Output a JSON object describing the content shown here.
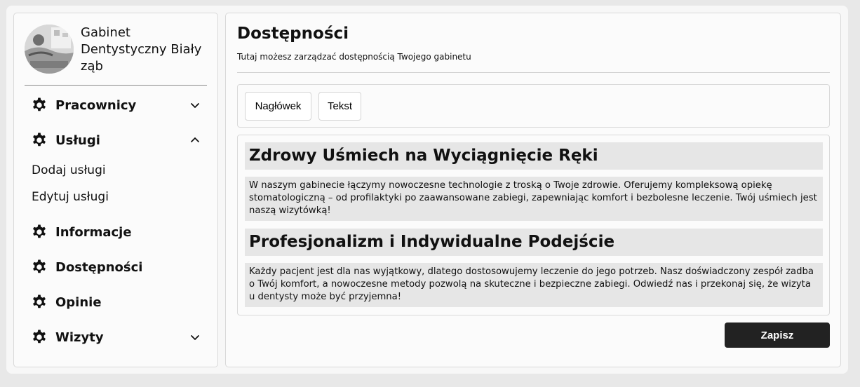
{
  "sidebar": {
    "brand_name": "Gabinet Dentystyczny Biały ząb",
    "nav": {
      "pracownicy": "Pracownicy",
      "uslugi": "Usługi",
      "uslugi_sub": [
        "Dodaj usługi",
        "Edytuj usługi"
      ],
      "informacje": "Informacje",
      "dostepnosci": "Dostępności",
      "opinie": "Opinie",
      "wizyty": "Wizyty"
    }
  },
  "main": {
    "title": "Dostępności",
    "subtitle": "Tutaj możesz zarządzać dostępnością Twojego gabinetu",
    "toolbar": {
      "heading_button": "Nagłówek",
      "text_button": "Tekst"
    },
    "content": [
      {
        "type": "heading",
        "text": "Zdrowy Uśmiech na Wyciągnięcie Ręki"
      },
      {
        "type": "paragraph",
        "text": "W naszym gabinecie łączymy nowoczesne technologie z troską o Twoje zdrowie. Oferujemy kompleksową opiekę stomatologiczną – od profilaktyki po zaawansowane zabiegi, zapewniając komfort i bezbolesne leczenie. Twój uśmiech jest naszą wizytówką!"
      },
      {
        "type": "heading",
        "text": "Profesjonalizm i Indywidualne Podejście"
      },
      {
        "type": "paragraph",
        "text": "Każdy pacjent jest dla nas wyjątkowy, dlatego dostosowujemy leczenie do jego potrzeb. Nasz doświadczony zespół zadba o Twój komfort, a nowoczesne metody pozwolą na skuteczne i bezpieczne zabiegi. Odwiedź nas i przekonaj się, że wizyta u dentysty może być przyjemna!"
      }
    ],
    "save_label": "Zapisz"
  }
}
